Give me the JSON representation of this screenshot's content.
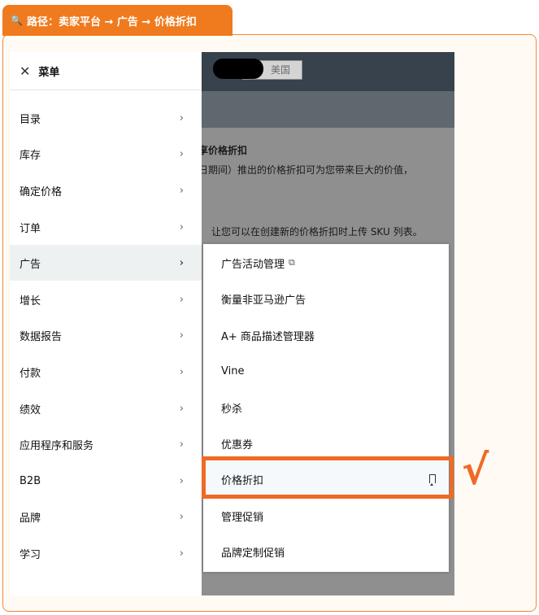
{
  "path_tag": {
    "icon": "magnifier-icon",
    "text": "路径：卖家平台 → 广告 → 价格折扣"
  },
  "top_bar": {
    "region": "美国"
  },
  "background_text": {
    "line1": "享价格折扣",
    "line2": "日期间）推出的价格折扣可为您带来巨大的价值，",
    "line3": "让您可以在创建新的价格折扣时上传 SKU 列表。"
  },
  "menu": {
    "title": "菜单",
    "items": [
      {
        "label": "目录"
      },
      {
        "label": "库存"
      },
      {
        "label": "确定价格"
      },
      {
        "label": "订单"
      },
      {
        "label": "广告"
      },
      {
        "label": "增长"
      },
      {
        "label": "数据报告"
      },
      {
        "label": "付款"
      },
      {
        "label": "绩效"
      },
      {
        "label": "应用程序和服务"
      },
      {
        "label": "B2B"
      },
      {
        "label": "品牌"
      },
      {
        "label": "学习"
      }
    ],
    "active_index": 4
  },
  "submenu": {
    "items": [
      {
        "label": "广告活动管理"
      },
      {
        "label": "衡量非亚马逊广告"
      },
      {
        "label": "A+ 商品描述管理器"
      },
      {
        "label": "Vine"
      },
      {
        "label": "秒杀"
      },
      {
        "label": "优惠券"
      },
      {
        "label": "价格折扣"
      },
      {
        "label": "管理促销"
      },
      {
        "label": "品牌定制促销"
      }
    ],
    "selected_index": 6
  },
  "annotation": {
    "mark": "√",
    "color": "#ef6a25"
  },
  "colors": {
    "accent": "#f07a1e",
    "frame": "#f08a3c",
    "header_dark": "#37424c"
  }
}
